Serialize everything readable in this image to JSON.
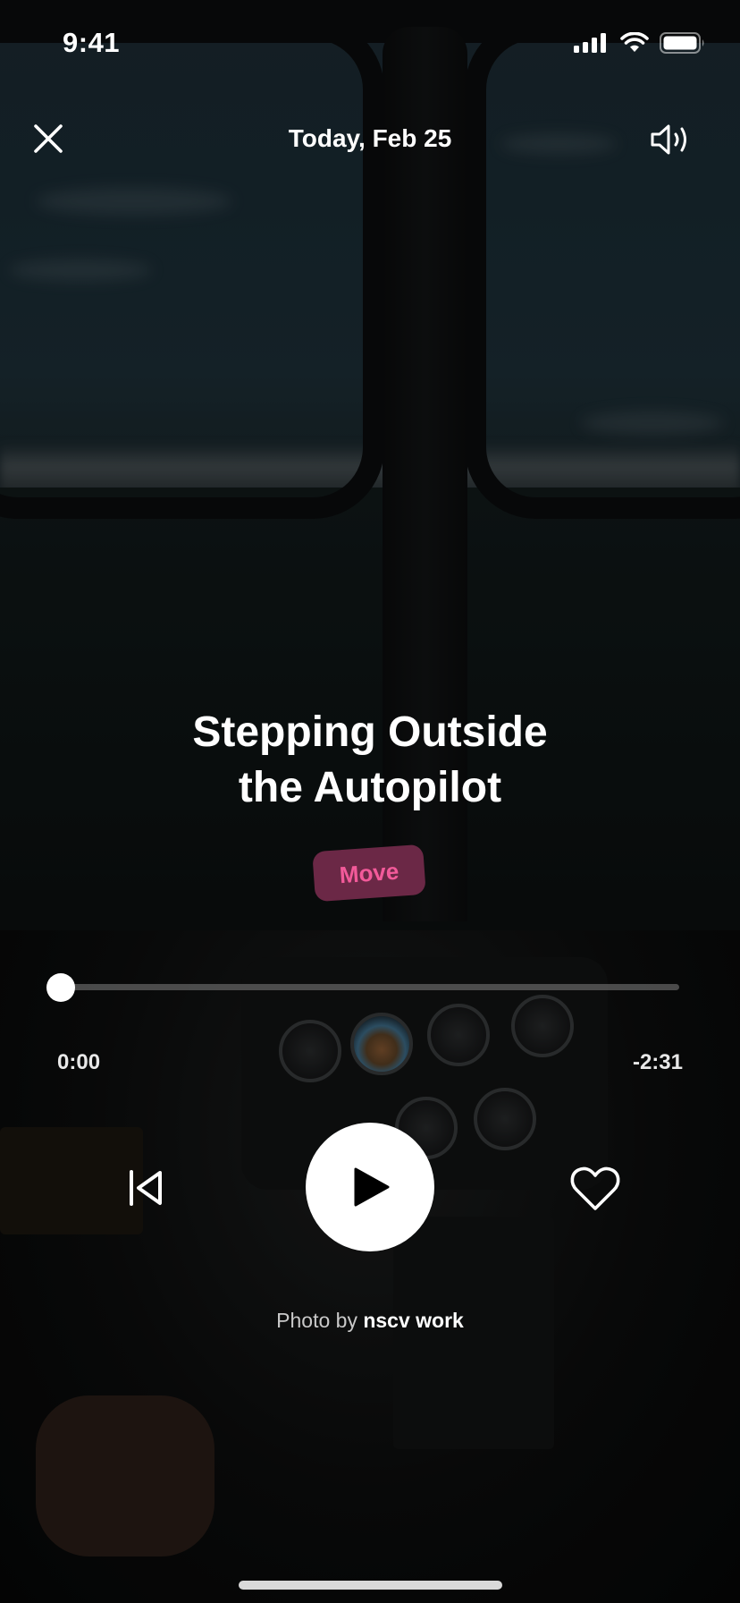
{
  "status_bar": {
    "time": "9:41",
    "icons": [
      "cellular-signal-icon",
      "wifi-icon",
      "battery-icon"
    ]
  },
  "header": {
    "title": "Today, Feb 25",
    "left_icon": "close-icon",
    "right_icon": "speaker-icon"
  },
  "track": {
    "title_line1": "Stepping Outside",
    "title_line2": "the Autopilot",
    "category": "Move"
  },
  "player": {
    "elapsed": "0:00",
    "remaining": "-2:31",
    "progress": 0,
    "prev_icon": "skip-back-icon",
    "play_icon": "play-icon",
    "like_icon": "heart-icon"
  },
  "credit": {
    "prefix": "Photo by",
    "author": "nscv work"
  },
  "colors": {
    "badge_background": "#6b2846",
    "badge_text": "#f35a9a",
    "accent_white": "#ffffff"
  }
}
